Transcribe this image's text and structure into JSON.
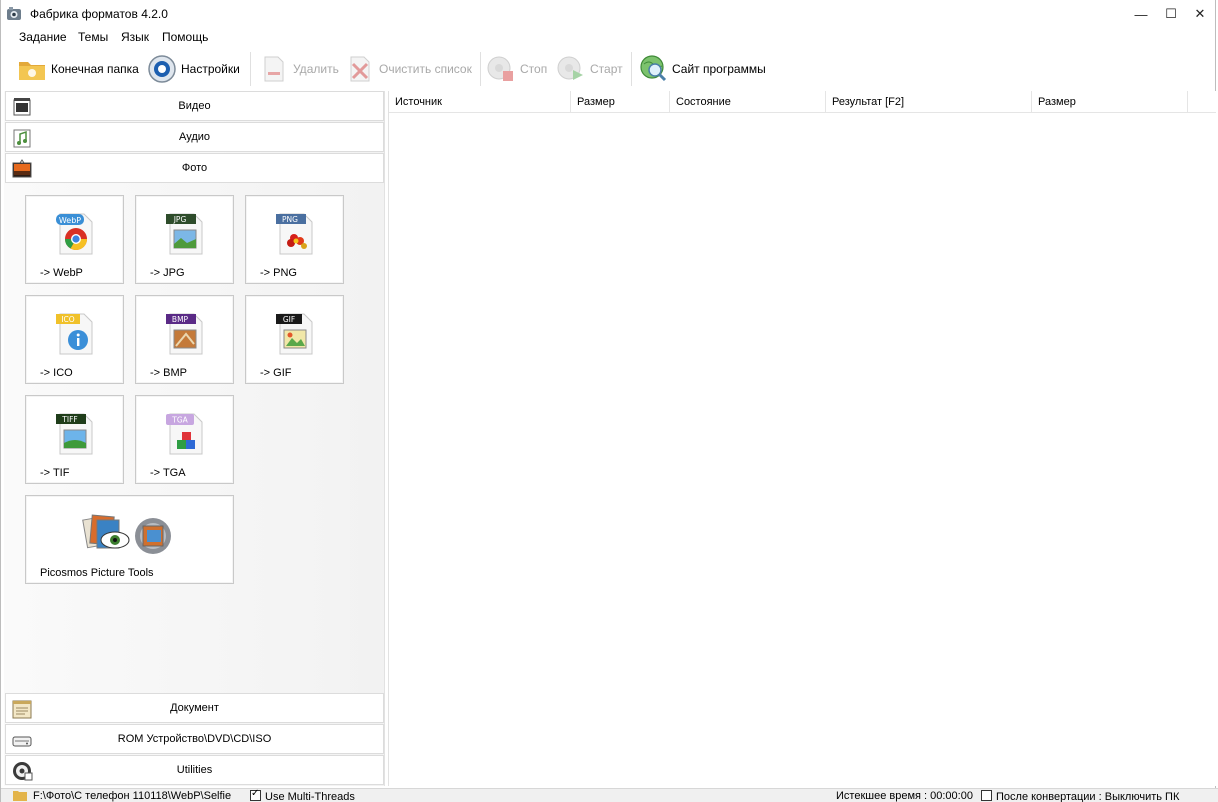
{
  "window": {
    "title": "Фабрика форматов 4.2.0",
    "minimize": "—",
    "maximize": "☐",
    "close": "✕"
  },
  "menu": [
    "Задание",
    "Темы",
    "Язык",
    "Помощь"
  ],
  "toolbar": {
    "output_folder": "Конечная папка",
    "settings": "Настройки",
    "remove": "Удалить",
    "clear_list": "Очистить список",
    "stop": "Стоп",
    "start": "Старт",
    "website": "Сайт программы"
  },
  "categories": {
    "video": "Видео",
    "audio": "Аудио",
    "photo": "Фото",
    "document": "Документ",
    "rom": "ROM Устройство\\DVD\\CD\\ISO",
    "utilities": "Utilities"
  },
  "photo_tiles": [
    {
      "label": "-> WebP",
      "badge": "WebP",
      "badge_color": "#3a8fd6"
    },
    {
      "label": "-> JPG",
      "badge": "JPG",
      "badge_color": "#2e4c2b"
    },
    {
      "label": "-> PNG",
      "badge": "PNG",
      "badge_color": "#4a6fa0"
    },
    {
      "label": "-> ICO",
      "badge": "ICO",
      "badge_color": "#f0c12a"
    },
    {
      "label": "-> BMP",
      "badge": "BMP",
      "badge_color": "#5a2a86"
    },
    {
      "label": "-> GIF",
      "badge": "GIF",
      "badge_color": "#1a1a1a"
    },
    {
      "label": "-> TIF",
      "badge": "TIFF",
      "badge_color": "#1f3d1a"
    },
    {
      "label": "-> TGA",
      "badge": "TGA",
      "badge_color": "#c7a6e0"
    }
  ],
  "picosmos_tile": {
    "label": "Picosmos Picture Tools"
  },
  "list_columns": [
    "Источник",
    "Размер",
    "Состояние",
    "Результат [F2]",
    "Размер"
  ],
  "statusbar": {
    "path": "F:\\Фото\\С телефон 110118\\WebP\\Selfie",
    "multithreads": "Use Multi-Threads",
    "elapsed": "Истекшее время : 00:00:00",
    "after_conversion": "После конвертации : Выключить ПК"
  }
}
